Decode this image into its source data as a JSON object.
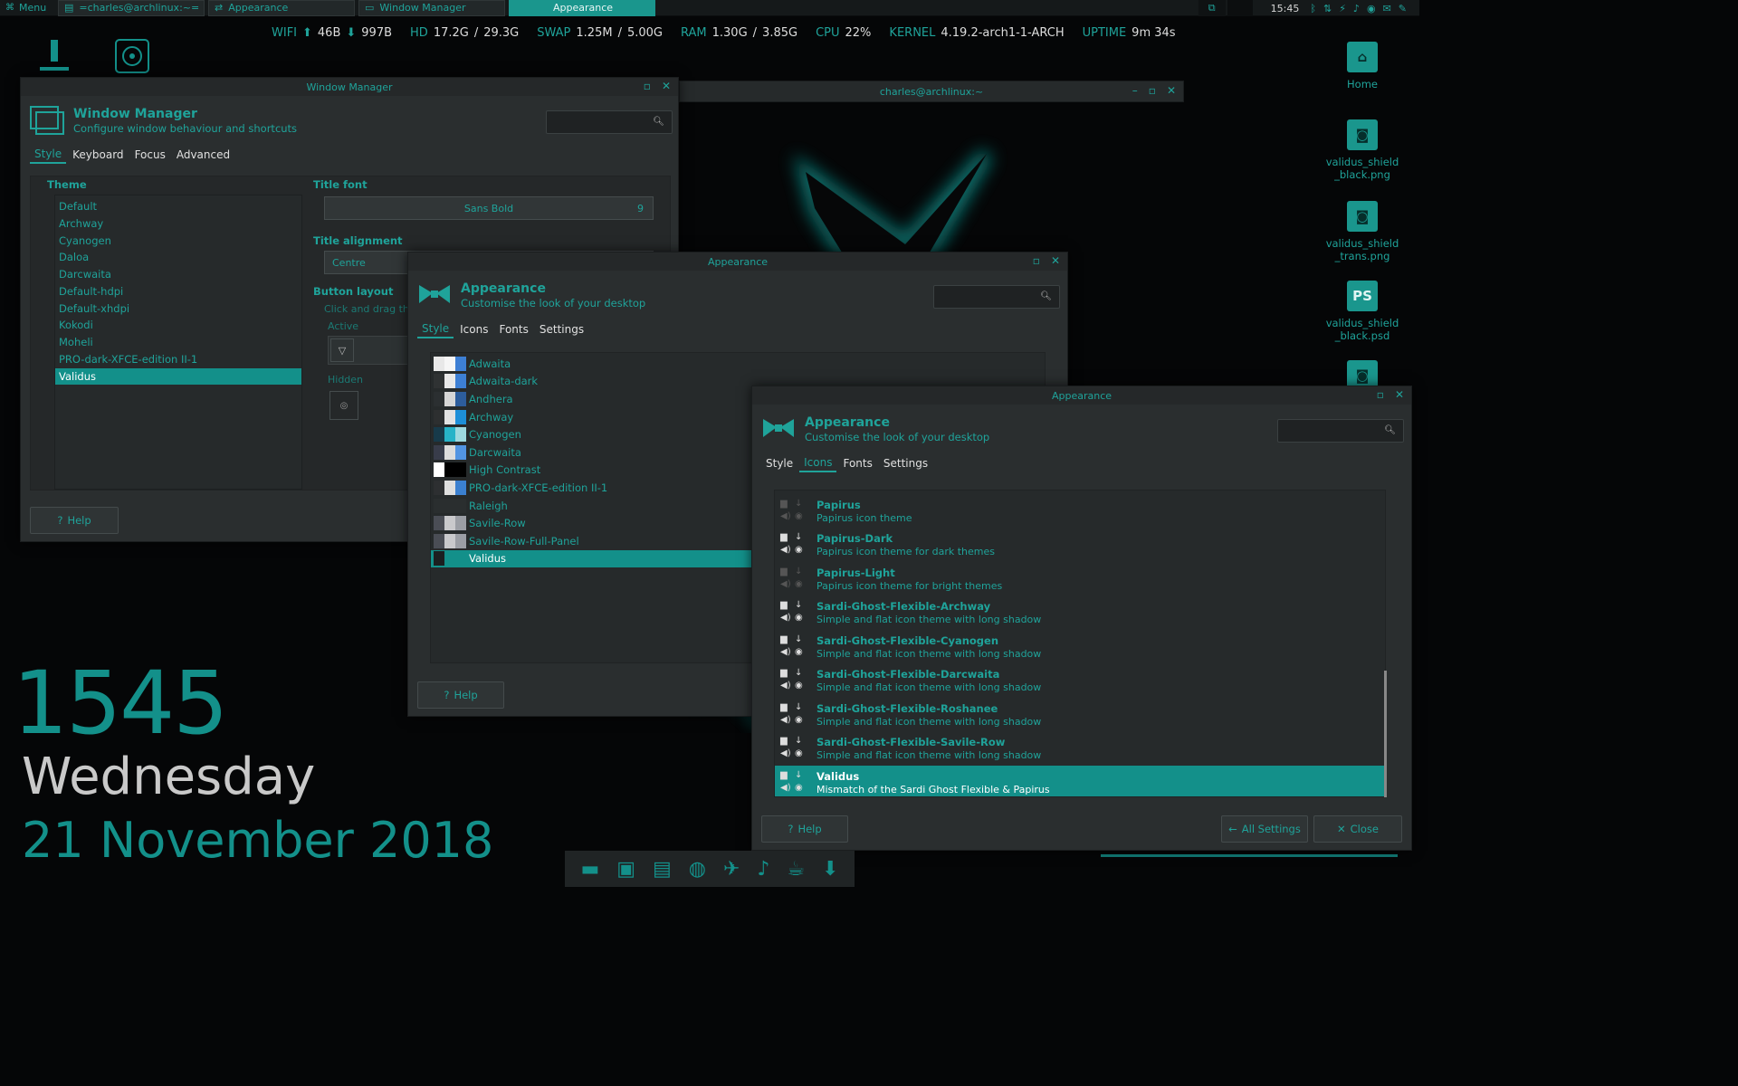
{
  "panel": {
    "menu_label": "Menu",
    "tasks": [
      {
        "label": "=charles@archlinux:~="
      },
      {
        "label": "Appearance"
      },
      {
        "label": "Window Manager"
      },
      {
        "label": "Appearance"
      }
    ],
    "clock": "15:45"
  },
  "conky": {
    "wifi_label": "WIFI",
    "wifi_up": "46B",
    "wifi_down": "997B",
    "hd_label": "HD",
    "hd_val": "17.2G",
    "hd_total": "29.3G",
    "swap_label": "SWAP",
    "swap_val": "1.25M",
    "swap_total": "5.00G",
    "ram_label": "RAM",
    "ram_val": "1.30G",
    "ram_total": "3.85G",
    "cpu_label": "CPU",
    "cpu_val": "22%",
    "kernel_label": "KERNEL",
    "kernel_val": "4.19.2-arch1-1-ARCH",
    "uptime_label": "UPTIME",
    "uptime_val": "9m 34s"
  },
  "desktop": {
    "icons": [
      {
        "label": "Home",
        "icon": "home-icon"
      },
      {
        "label": "validus_shield_black.png",
        "icon": "image-file-icon"
      },
      {
        "label": "validus_shield_trans.png",
        "icon": "image-file-icon"
      },
      {
        "label": "validus_shield_black.psd",
        "icon": "psd-file-icon",
        "badge": "PS"
      }
    ]
  },
  "clock": {
    "time": "1545",
    "day": "Wednesday",
    "date": "21 November 2018"
  },
  "terminal": {
    "title": "charles@archlinux:~"
  },
  "wm": {
    "title": "Window Manager",
    "header_title": "Window Manager",
    "header_sub": "Configure window behaviour and shortcuts",
    "tabs": [
      "Style",
      "Keyboard",
      "Focus",
      "Advanced"
    ],
    "theme_label": "Theme",
    "themes": [
      "Default",
      "Archway",
      "Cyanogen",
      "Daloa",
      "Darcwaita",
      "Default-hdpi",
      "Default-xhdpi",
      "Kokodi",
      "Moheli",
      "PRO-dark-XFCE-edition II-1",
      "Validus"
    ],
    "selected_theme": "Validus",
    "title_font_label": "Title font",
    "title_font": "Sans Bold",
    "title_font_size": "9",
    "title_align_label": "Title alignment",
    "title_align": "Centre",
    "button_layout_label": "Button layout",
    "button_layout_hint": "Click and drag the",
    "active_label": "Active",
    "hidden_label": "Hidden",
    "help": "Help"
  },
  "appearance1": {
    "title": "Appearance",
    "header_title": "Appearance",
    "header_sub": "Customise the look of your desktop",
    "tabs": [
      "Style",
      "Icons",
      "Fonts",
      "Settings"
    ],
    "styles": [
      {
        "name": "Adwaita",
        "c": [
          "#e8e8e8",
          "#f6f6f6",
          "#3d7fd4"
        ]
      },
      {
        "name": "Adwaita-dark",
        "c": [
          "#2f3233",
          "#e8e8e8",
          "#3d7fd4"
        ]
      },
      {
        "name": "Andhera",
        "c": [
          "#2b2f31",
          "#d6d6d6",
          "#2d5d9c"
        ]
      },
      {
        "name": "Archway",
        "c": [
          "#2d2f30",
          "#e2e2e2",
          "#1d8fd8"
        ]
      },
      {
        "name": "Cyanogen",
        "c": [
          "#173a4a",
          "#27b3c8",
          "#9ed9df"
        ]
      },
      {
        "name": "Darcwaita",
        "c": [
          "#383c4a",
          "#dcdcdc",
          "#5294e2"
        ]
      },
      {
        "name": "High Contrast",
        "c": [
          "#ffffff",
          "#000000",
          "#000000"
        ]
      },
      {
        "name": "PRO-dark-XFCE-edition II-1",
        "c": [
          "#2d2f31",
          "#dedede",
          "#3b80d0"
        ]
      },
      {
        "name": "Raleigh",
        "c": [
          "#2a2e2f",
          "#2a2e2f",
          "#2a2e2f"
        ]
      },
      {
        "name": "Savile-Row",
        "c": [
          "#4a4d55",
          "#c9c9cc",
          "#9b9ea5"
        ]
      },
      {
        "name": "Savile-Row-Full-Panel",
        "c": [
          "#4a4d55",
          "#c9c9cc",
          "#9b9ea5"
        ]
      },
      {
        "name": "Validus",
        "c": [
          "#1c1f20",
          "#13908a",
          "#13908a"
        ]
      }
    ],
    "selected_style": "Validus",
    "help": "Help"
  },
  "appearance2": {
    "title": "Appearance",
    "header_title": "Appearance",
    "header_sub": "Customise the look of your desktop",
    "tabs": [
      "Style",
      "Icons",
      "Fonts",
      "Settings"
    ],
    "icons": [
      {
        "name": "Papirus",
        "desc": "Papirus icon theme",
        "dim": true
      },
      {
        "name": "Papirus-Dark",
        "desc": "Papirus icon theme for dark themes",
        "dim": false
      },
      {
        "name": "Papirus-Light",
        "desc": "Papirus icon theme for bright themes",
        "dim": true
      },
      {
        "name": "Sardi-Ghost-Flexible-Archway",
        "desc": "Simple and flat icon theme with long shadow",
        "dim": false
      },
      {
        "name": "Sardi-Ghost-Flexible-Cyanogen",
        "desc": "Simple and flat icon theme with long shadow",
        "dim": false
      },
      {
        "name": "Sardi-Ghost-Flexible-Darcwaita",
        "desc": "Simple and flat icon theme with long shadow",
        "dim": false
      },
      {
        "name": "Sardi-Ghost-Flexible-Roshanee",
        "desc": "Simple and flat icon theme with long shadow",
        "dim": false
      },
      {
        "name": "Sardi-Ghost-Flexible-Savile-Row",
        "desc": "Simple and flat icon theme with long shadow",
        "dim": false
      },
      {
        "name": "Validus",
        "desc": "Mismatch of the Sardi Ghost Flexible & Papirus",
        "dim": false
      }
    ],
    "selected_icon": "Validus",
    "help": "Help",
    "all_settings": "All Settings",
    "close": "Close"
  },
  "colors": {
    "accent": "#13908a",
    "accent_text": "#1fa39a",
    "window_bg": "#2a2e2f",
    "desktop_bg": "#050607"
  }
}
